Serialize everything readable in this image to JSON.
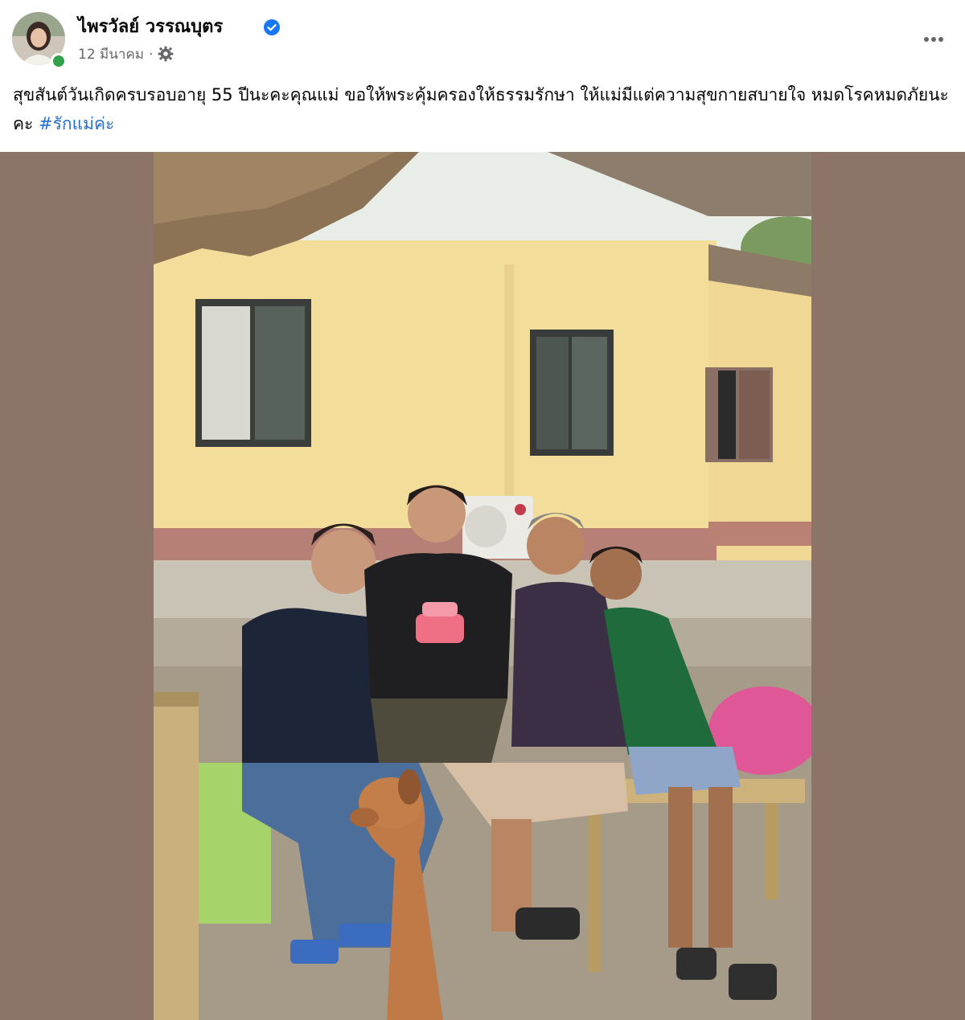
{
  "post": {
    "author_name": "ไพรวัลย์ วรรณบุตร",
    "timestamp": "12 มีนาคม",
    "separator": "·",
    "verified": true,
    "audience_icon": "gear-icon",
    "more_icon": "more-options-icon",
    "text": "สุขสันต์วันเกิดครบรอบอายุ 55 ปีนะคะคุณแม่ ขอให้พระคุ้มครองให้ธรรมรักษา ให้แม่มีแต่ความสุขกายสบายใจ หมดโรคหมดภัยนะคะ ",
    "hashtag": "#รักแม่ค่ะ",
    "colors": {
      "link": "#216fdb",
      "verified": "#1877f2",
      "online": "#31a24c",
      "media_background": "#8d7468"
    }
  }
}
